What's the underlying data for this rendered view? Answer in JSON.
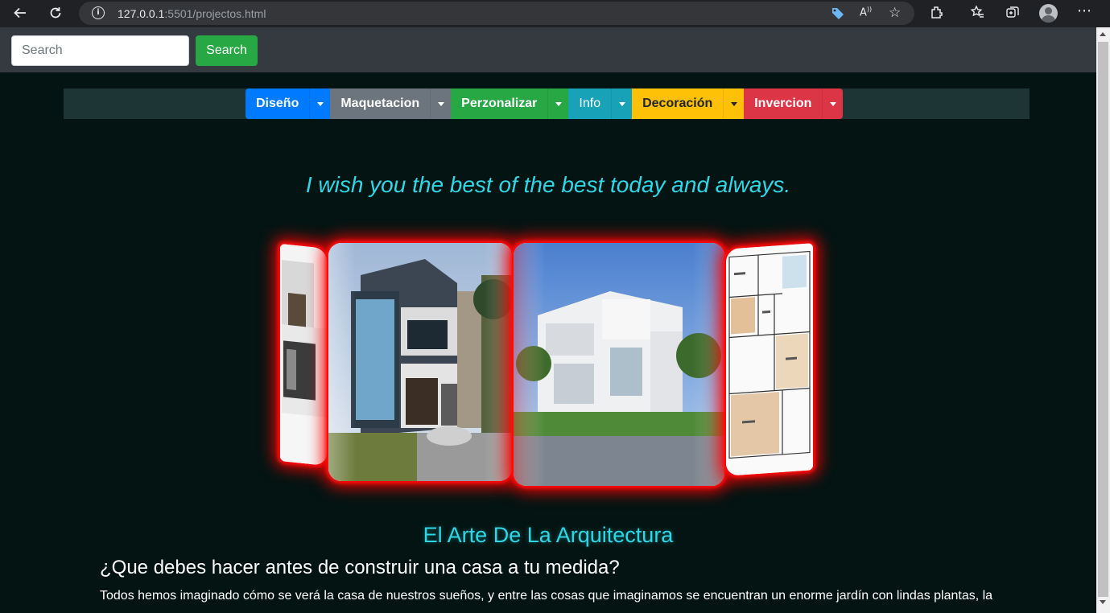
{
  "browser": {
    "url_host": "127.0.0.1",
    "url_rest": ":5501/projectos.html",
    "icons": [
      "back-arrow-icon",
      "reload-icon",
      "site-info-icon",
      "tag-icon",
      "read-aloud-icon",
      "favorite-add-icon",
      "extensions-icon",
      "favorites-icon",
      "collections-icon",
      "profile-icon",
      "more-icon"
    ]
  },
  "search": {
    "placeholder": "Search",
    "button_label": "Search"
  },
  "menu": {
    "items": [
      {
        "label": "Diseño",
        "color": "#007bff",
        "text_color": "#ffffff"
      },
      {
        "label": "Maquetacion",
        "color": "#6c757d",
        "text_color": "#ffffff"
      },
      {
        "label": "Perzonalizar",
        "color": "#28a745",
        "text_color": "#ffffff"
      },
      {
        "label": "Info",
        "color": "#17a2b8",
        "text_color": "#ffffff"
      },
      {
        "label": "Decoración",
        "color": "#ffc107",
        "text_color": "#212529"
      },
      {
        "label": "Invercion",
        "color": "#dc3545",
        "text_color": "#ffffff"
      }
    ]
  },
  "tagline": "I wish you the best of the best today and always.",
  "article": {
    "heading": "El Arte De La Arquitectura",
    "question": "¿Que debes hacer antes de construir una casa a tu medida?",
    "paragraph": "Todos hemos imaginado cómo se verá la casa de nuestros sueños, y entre las cosas que imaginamos se encuentran un enorme jardín con lindas plantas, la"
  },
  "colors": {
    "page_bg": "#041412",
    "topbar_bg": "#343a40",
    "accent_cyan": "#2fd6e6",
    "glow_red": "#ff0000"
  }
}
